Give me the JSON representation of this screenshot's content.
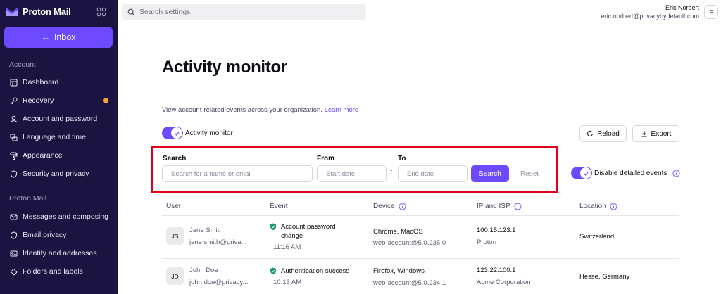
{
  "sidebar": {
    "brand": "Proton Mail",
    "inbox_label": "Inbox",
    "sections": [
      {
        "label": "Account",
        "items": [
          {
            "label": "Dashboard",
            "icon": "dashboard-icon"
          },
          {
            "label": "Recovery",
            "icon": "key-icon",
            "badge_color": "#f5a13a"
          },
          {
            "label": "Account and password",
            "icon": "account-icon"
          },
          {
            "label": "Language and time",
            "icon": "language-icon"
          },
          {
            "label": "Appearance",
            "icon": "paint-roller-icon"
          },
          {
            "label": "Security and privacy",
            "icon": "shield-icon"
          }
        ]
      },
      {
        "label": "Proton Mail",
        "items": [
          {
            "label": "Messages and composing",
            "icon": "envelope-icon"
          },
          {
            "label": "Email privacy",
            "icon": "shield-icon"
          },
          {
            "label": "Identity and addresses",
            "icon": "id-card-icon"
          },
          {
            "label": "Folders and labels",
            "icon": "tag-icon"
          }
        ]
      }
    ]
  },
  "topbar": {
    "search_placeholder": "Search settings",
    "user_name": "Eric Norbert",
    "user_email": "eric.norbert@privacybydefault.com",
    "avatar_initial": "F"
  },
  "main": {
    "title": "Activity monitor",
    "description": "View account-related events across your organization.",
    "learn_more": "Learn more",
    "activity_toggle_label": "Activity monitor",
    "reload_label": "Reload",
    "export_label": "Export",
    "filters": {
      "search_label": "Search",
      "search_placeholder": "Search for a name or email",
      "from_label": "From",
      "from_placeholder": "Start date",
      "separator": "-",
      "to_label": "To",
      "to_placeholder": "End date",
      "search_button": "Search",
      "reset_button": "Reset"
    },
    "detailed_toggle_label": "Disable detailed events",
    "table": {
      "columns": [
        "User",
        "Event",
        "Device",
        "IP and ISP",
        "Location"
      ],
      "rows": [
        {
          "initials": "JS",
          "name": "Jane Smith",
          "email": "jane.smith@priva...",
          "event_lines": [
            "Account password",
            "change"
          ],
          "time": "11:16 AM",
          "device": "Chrome, MacOS",
          "device_sub": "web-account@5.0.235.0",
          "ip": "100.15.123.1",
          "isp": "Proton",
          "location": "Switzerland"
        },
        {
          "initials": "JD",
          "name": "John Doe",
          "email": "john.doe@privacy...",
          "event_lines": [
            "Authentication success"
          ],
          "time": "10:13 AM",
          "device": "Firefox, Windows",
          "device_sub": "web-account@5.0.234.1",
          "ip": "123.22.100.1",
          "isp": "Acme Corporation",
          "location": "Hesse, Germany"
        }
      ]
    }
  },
  "colors": {
    "sidebar_bg": "#1b1340",
    "accent": "#6d4aff",
    "highlight_box": "#e0001b",
    "success_shield": "#1c9b73"
  }
}
